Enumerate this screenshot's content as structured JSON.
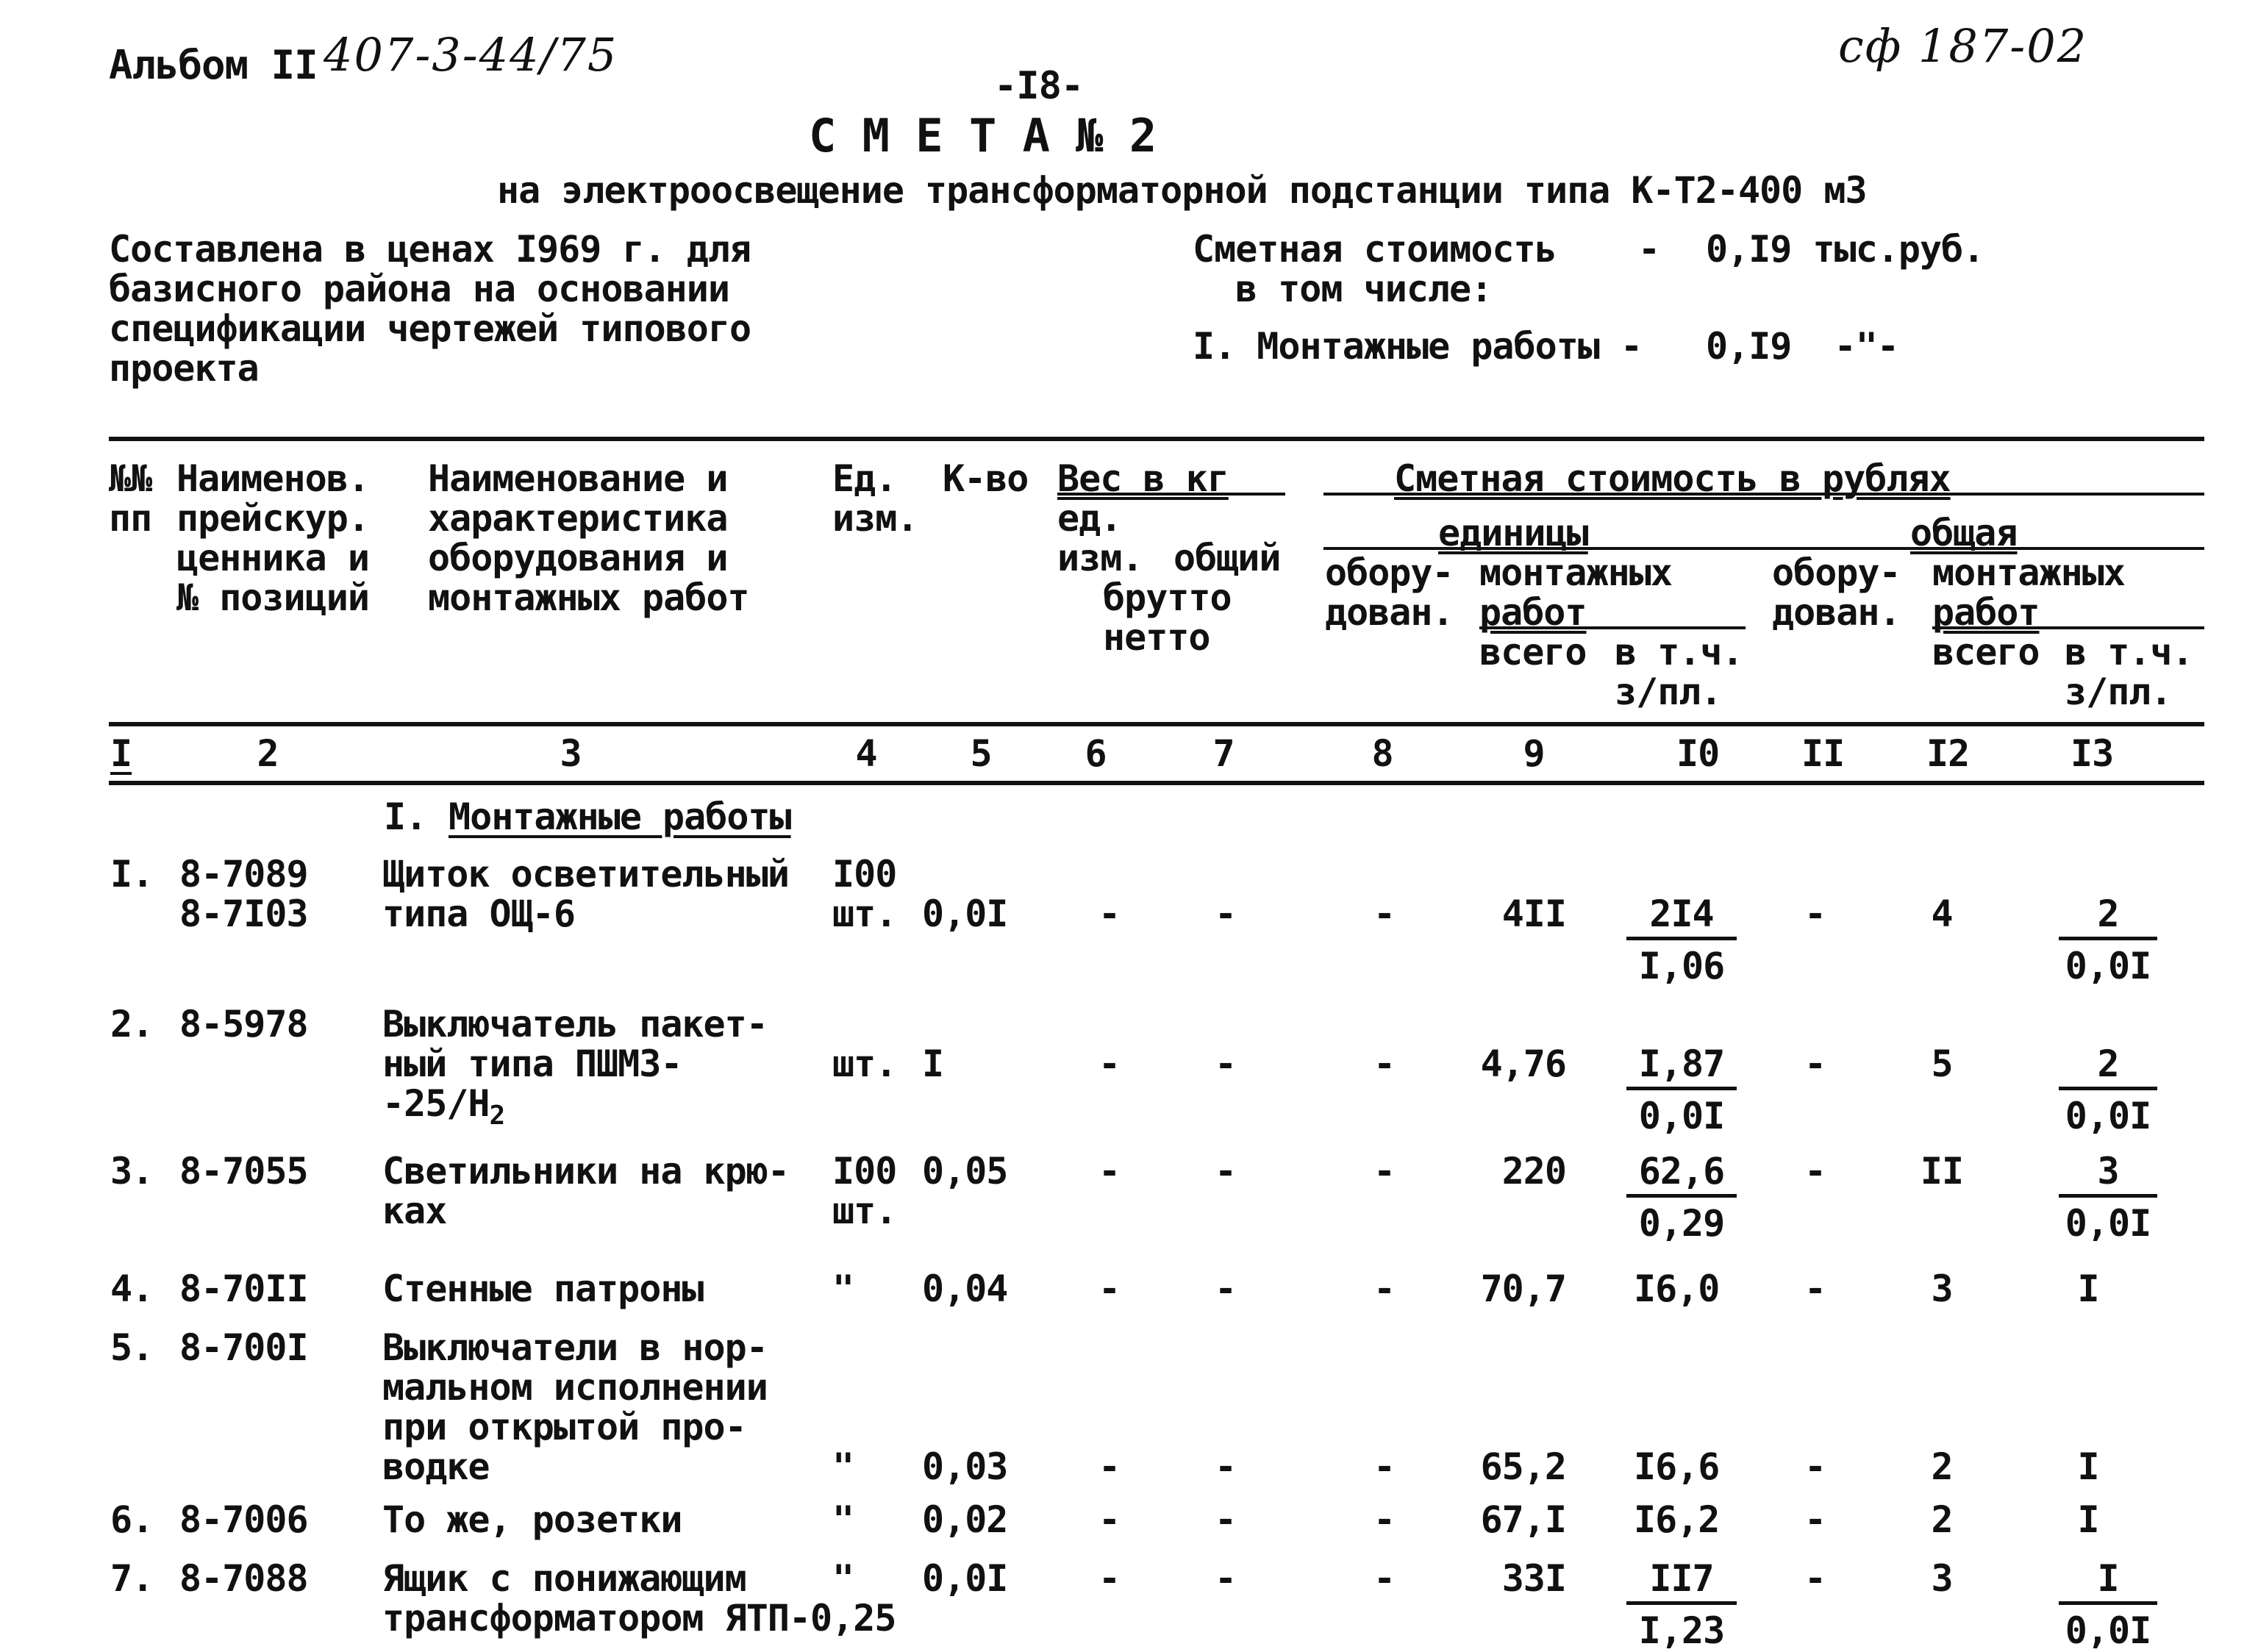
{
  "header": {
    "album_label": "Альбом II",
    "album_handwritten": "407-3-44/75",
    "stamp_handwritten": "сф 187-02",
    "page_number": "-I8-",
    "title": "С М Е Т А № 2",
    "subtitle": "на электроосвещение трансформаторной подстанции типа К-Т2-400 м3"
  },
  "info": {
    "basis_lines": [
      "Составлена в ценах I969 г. для",
      "базисного района на основании",
      "спецификации чертежей типового",
      "проекта"
    ],
    "cost_label": "Сметная стоимость",
    "cost_dash": "-",
    "cost_value": "0,I9 тыс.руб.",
    "including_label": "в том числе:",
    "installation_label": "I. Монтажные работы -",
    "installation_value": "0,I9  -\"-"
  },
  "table": {
    "headers": {
      "col1": [
        "№№",
        "пп"
      ],
      "col2": [
        "Наименов.",
        "прейскур.",
        "ценника и",
        "№ позиций"
      ],
      "col3": [
        "Наименование и",
        "характеристика",
        "оборудования и",
        "монтажных работ"
      ],
      "col4": [
        "Ед.",
        "изм."
      ],
      "col5": "К-во",
      "weight_group": "Вес в кг",
      "weight_unit": [
        "ед.",
        "изм."
      ],
      "weight_total": "общий",
      "weight_gross_net": [
        "брутто",
        "нетто"
      ],
      "cost_group": "Сметная стоимость в рублях",
      "unit_group": "единицы",
      "total_group": "общая",
      "equipment": [
        "обору-",
        "дован."
      ],
      "installation": [
        "монтажных",
        "работ"
      ],
      "total_sub": "всего",
      "wages_sub": [
        "в т.ч.",
        "з/пл."
      ]
    },
    "column_numbers": [
      "I",
      "2",
      "3",
      "4",
      "5",
      "6",
      "7",
      "8",
      "9",
      "I0",
      "II",
      "I2",
      "I3"
    ],
    "section_number": "I.",
    "section_title": "Монтажные работы",
    "rows": [
      {
        "n": "I.",
        "codes": [
          "8-7089",
          "8-7I03"
        ],
        "name": [
          "Щиток осветительный",
          "типа ОЩ-6"
        ],
        "unit": [
          "I00",
          "шт."
        ],
        "qty": "0,0I",
        "w_unit": "-",
        "w_total": "-",
        "equip_unit": "-",
        "inst_unit_total": "4II",
        "inst_unit_wage": "2I4",
        "inst_unit_wage_sub": "I,06",
        "equip_total": "-",
        "inst_total": "4",
        "inst_total_wage": "2",
        "inst_total_wage_sub": "0,0I"
      },
      {
        "n": "2.",
        "codes": [
          "8-5978"
        ],
        "name": [
          "Выключатель пакет-",
          "ный типа ПШМ3-",
          "-25/Н"
        ],
        "name_sub": "2",
        "unit": [
          "шт."
        ],
        "qty": "I",
        "w_unit": "-",
        "w_total": "-",
        "equip_unit": "-",
        "inst_unit_total": "4,76",
        "inst_unit_wage": "I,87",
        "inst_unit_wage_sub": "0,0I",
        "equip_total": "-",
        "inst_total": "5",
        "inst_total_wage": "2",
        "inst_total_wage_sub": "0,0I"
      },
      {
        "n": "3.",
        "codes": [
          "8-7055"
        ],
        "name": [
          "Светильники на крю-",
          "ках"
        ],
        "unit": [
          "I00",
          "шт."
        ],
        "qty": "0,05",
        "w_unit": "-",
        "w_total": "-",
        "equip_unit": "-",
        "inst_unit_total": "220",
        "inst_unit_wage": "62,6",
        "inst_unit_wage_sub": "0,29",
        "equip_total": "-",
        "inst_total": "II",
        "inst_total_wage": "3",
        "inst_total_wage_sub": "0,0I"
      },
      {
        "n": "4.",
        "codes": [
          "8-70II"
        ],
        "name": [
          "Стенные патроны"
        ],
        "unit": [
          "\""
        ],
        "qty": "0,04",
        "w_unit": "-",
        "w_total": "-",
        "equip_unit": "-",
        "inst_unit_total": "70,7",
        "inst_unit_wage": "I6,0",
        "equip_total": "-",
        "inst_total": "3",
        "inst_total_wage": "I"
      },
      {
        "n": "5.",
        "codes": [
          "8-700I"
        ],
        "name": [
          "Выключатели в нор-",
          "мальном исполнении",
          "при открытой про-",
          "водке"
        ],
        "unit": [
          "\""
        ],
        "qty": "0,03",
        "w_unit": "-",
        "w_total": "-",
        "equip_unit": "-",
        "inst_unit_total": "65,2",
        "inst_unit_wage": "I6,6",
        "equip_total": "-",
        "inst_total": "2",
        "inst_total_wage": "I"
      },
      {
        "n": "6.",
        "codes": [
          "8-7006"
        ],
        "name": [
          "То же, розетки"
        ],
        "unit": [
          "\""
        ],
        "qty": "0,02",
        "w_unit": "-",
        "w_total": "-",
        "equip_unit": "-",
        "inst_unit_total": "67,I",
        "inst_unit_wage": "I6,2",
        "equip_total": "-",
        "inst_total": "2",
        "inst_total_wage": "I"
      },
      {
        "n": "7.",
        "codes": [
          "8-7088"
        ],
        "name": [
          "Ящик с понижающим",
          "трансформатором ЯТП-0,25"
        ],
        "unit": [
          "\""
        ],
        "qty": "0,0I",
        "w_unit": "-",
        "w_total": "-",
        "equip_unit": "-",
        "inst_unit_total": "33I",
        "inst_unit_wage": "II7",
        "inst_unit_wage_sub": "I,23",
        "equip_total": "-",
        "inst_total": "3",
        "inst_total_wage": "I",
        "inst_total_wage_sub": "0,0I"
      }
    ]
  }
}
